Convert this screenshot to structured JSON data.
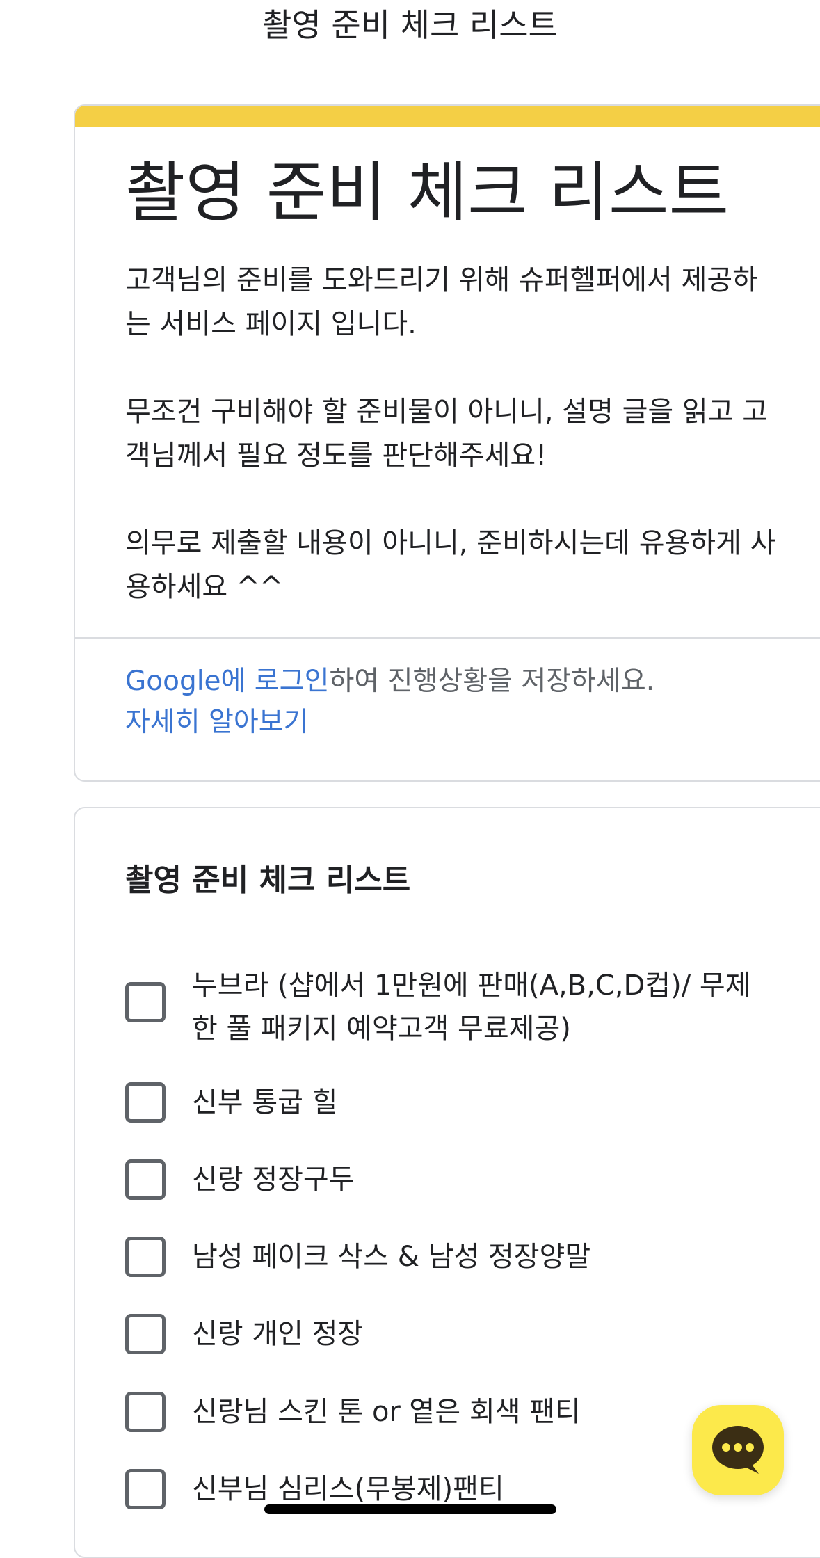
{
  "page": {
    "title": "촬영 준비 체크 리스트"
  },
  "header": {
    "form_title": "촬영 준비 체크 리스트",
    "description": [
      "고객님의 준비를 도와드리기 위해 슈퍼헬퍼에서 제공하는 서비스 페이지 입니다.",
      "무조건 구비해야 할 준비물이 아니니, 설명 글을 읽고 고객님께서 필요 정도를 판단해주세요!",
      "의무로 제출할 내용이 아니니, 준비하시는데 유용하게 사용하세요 ^^"
    ],
    "login_link": "Google에 로그인",
    "login_suffix": "하여 진행상황을 저장하세요.",
    "learn_more": "자세히 알아보기"
  },
  "question": {
    "title": "촬영 준비 체크 리스트",
    "options": [
      {
        "label": "누브라 (샵에서 1만원에 판매(A,B,C,D컵)/ 무제한 풀 패키지 예약고객 무료제공)",
        "checked": false
      },
      {
        "label": "신부 통굽 힐",
        "checked": false
      },
      {
        "label": "신랑 정장구두",
        "checked": false
      },
      {
        "label": "남성 페이크 삭스 & 남성 정장양말",
        "checked": false
      },
      {
        "label": "신랑 개인 정장",
        "checked": false
      },
      {
        "label": "신랑님 스킨 톤 or 옅은 회색 팬티",
        "checked": false
      },
      {
        "label": "신부님 심리스(무봉제)팬티",
        "checked": false
      }
    ]
  },
  "colors": {
    "accent": "#f4cf45",
    "link": "#3a74d1",
    "chat_button": "#fce94b"
  },
  "icons": {
    "chat": "chat-bubble-icon"
  }
}
